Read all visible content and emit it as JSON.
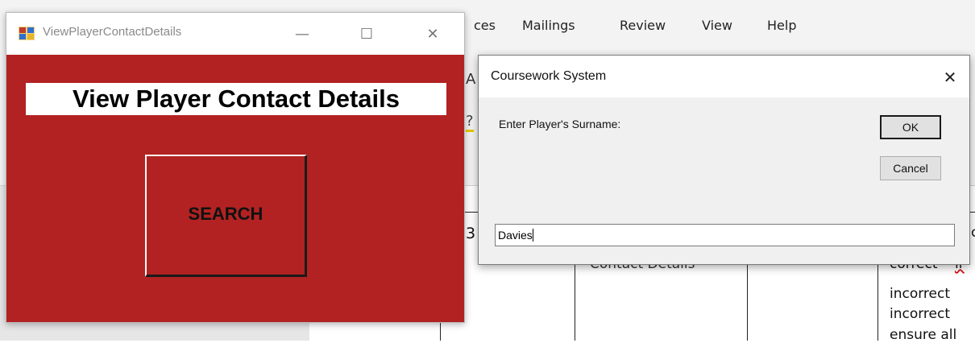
{
  "word": {
    "menu": [
      "ces",
      "Mailings",
      "Review",
      "View",
      "Help"
    ],
    "ribbon_fragments": [
      "A",
      "?"
    ],
    "page_fragments": [
      "3",
      "Contact Details",
      "c",
      "correct",
      "ir",
      "incorrect",
      "incorrect",
      "ensure all"
    ]
  },
  "form": {
    "title": "ViewPlayerContactDetails",
    "minimize_glyph": "—",
    "maximize_glyph": "☐",
    "close_glyph": "✕",
    "heading": "View Player Contact Details",
    "search_label": "SEARCH",
    "bg_color": "#b22222"
  },
  "dialog": {
    "title": "Coursework System",
    "close_glyph": "✕",
    "prompt": "Enter Player's Surname:",
    "ok_label": "OK",
    "cancel_label": "Cancel",
    "input_value": "Davies"
  }
}
